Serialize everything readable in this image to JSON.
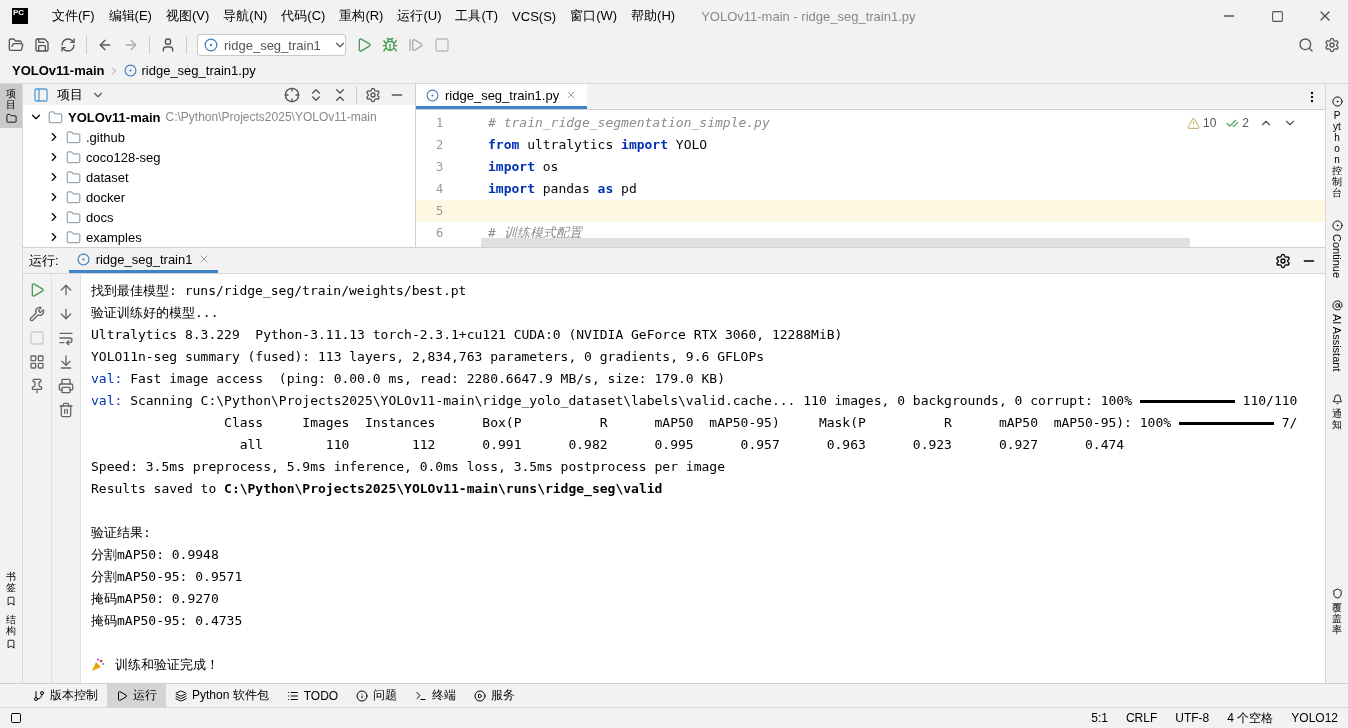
{
  "app": {
    "logo": "PC",
    "menu": [
      "文件(F)",
      "编辑(E)",
      "视图(V)",
      "导航(N)",
      "代码(C)",
      "重构(R)",
      "运行(U)",
      "工具(T)",
      "VCS(S)",
      "窗口(W)",
      "帮助(H)"
    ],
    "title": "YOLOv11-main - ridge_seg_train1.py"
  },
  "toolbar": {
    "run_config": "ridge_seg_train1"
  },
  "breadcrumb": [
    "YOLOv11-main",
    "ridge_seg_train1.py"
  ],
  "left_strip": [
    {
      "label": "项目",
      "selected": true
    },
    {
      "label": "书签",
      "selected": false
    },
    {
      "label": "结构",
      "selected": false
    }
  ],
  "project": {
    "title": "项目",
    "root": {
      "name": "YOLOv11-main",
      "path": "C:\\Python\\Projects2025\\YOLOv11-main",
      "expanded": true,
      "children": [
        {
          "name": ".github",
          "expanded": false
        },
        {
          "name": "coco128-seg",
          "expanded": false
        },
        {
          "name": "dataset",
          "expanded": false
        },
        {
          "name": "docker",
          "expanded": false
        },
        {
          "name": "docs",
          "expanded": false
        },
        {
          "name": "examples",
          "expanded": false
        }
      ]
    }
  },
  "editor": {
    "tabs": [
      {
        "label": "ridge_seg_train1.py",
        "selected": true
      }
    ],
    "warnings": "10",
    "checks": "2",
    "lines": [
      {
        "number": "1",
        "current": false,
        "tokens": [
          {
            "kind": "comment",
            "text": "# train_ridge_segmentation_simple.py"
          }
        ]
      },
      {
        "number": "2",
        "current": false,
        "tokens": [
          {
            "kind": "keyword",
            "text": "from"
          },
          {
            "kind": "plain",
            "text": " ultralytics "
          },
          {
            "kind": "keyword",
            "text": "import"
          },
          {
            "kind": "plain",
            "text": " YOLO"
          }
        ]
      },
      {
        "number": "3",
        "current": false,
        "tokens": [
          {
            "kind": "keyword",
            "text": "import"
          },
          {
            "kind": "plain",
            "text": " os"
          }
        ]
      },
      {
        "number": "4",
        "current": false,
        "tokens": [
          {
            "kind": "keyword",
            "text": "import"
          },
          {
            "kind": "plain",
            "text": " pandas "
          },
          {
            "kind": "keyword",
            "text": "as"
          },
          {
            "kind": "plain",
            "text": " pd"
          }
        ]
      },
      {
        "number": "5",
        "current": true
      },
      {
        "number": "6",
        "current": false,
        "tokens": [
          {
            "kind": "comment",
            "text": "# 训练模式配置"
          }
        ]
      }
    ]
  },
  "run": {
    "label": "运行:",
    "tab": "ridge_seg_train1",
    "console": [
      {
        "kind": "text",
        "text": "找到最佳模型: runs/ridge_seg/train/weights/best.pt"
      },
      {
        "kind": "text",
        "text": "验证训练好的模型..."
      },
      {
        "kind": "text",
        "text": "Ultralytics 8.3.229  Python-3.11.13 torch-2.3.1+cu121 CUDA:0 (NVIDIA GeForce RTX 3060, 12288MiB)"
      },
      {
        "kind": "text",
        "text": "YOLO11n-seg summary (fused): 113 layers, 2,834,763 parameters, 0 gradients, 9.6 GFLOPs"
      },
      {
        "kind": "tagged",
        "tag": "val:",
        "text": " Fast image access  (ping: 0.00.0 ms, read: 2280.6647.9 MB/s, size: 179.0 KB)"
      },
      {
        "kind": "progress",
        "tag": "val:",
        "text": " Scanning C:\\Python\\Projects2025\\YOLOv11-main\\ridge_yolo_dataset\\labels\\valid.cache... 110 images, 0 backgrounds, 0 corrupt: 100% ",
        "level": 1,
        "after": " 110/110"
      },
      {
        "kind": "progress",
        "text": "                 Class     Images  Instances      Box(P          R      mAP50  mAP50-95)     Mask(P          R      mAP50  mAP50-95): 100% ",
        "level": 1,
        "after": " 7/"
      },
      {
        "kind": "text",
        "text": "                   all        110        112      0.991      0.982      0.995      0.957      0.963      0.923      0.927      0.474"
      },
      {
        "kind": "text",
        "text": "Speed: 3.5ms preprocess, 5.9ms inference, 0.0ms loss, 3.5ms postprocess per image"
      },
      {
        "kind": "text",
        "text": "Results saved to **C:\\Python\\Projects2025\\YOLOv11-main\\runs\\ridge_seg\\valid**"
      },
      {
        "kind": "gap"
      },
      {
        "kind": "text",
        "text": "验证结果:"
      },
      {
        "kind": "text",
        "text": "分割mAP50: 0.9948"
      },
      {
        "kind": "text",
        "text": "分割mAP50-95: 0.9571"
      },
      {
        "kind": "text",
        "text": "掩码mAP50: 0.9270"
      },
      {
        "kind": "text",
        "text": "掩码mAP50-95: 0.4735"
      },
      {
        "kind": "gap"
      },
      {
        "kind": "party",
        "text": "训练和验证完成！"
      }
    ]
  },
  "right_strip": [
    "Python 控制台",
    "Continue",
    "AI Assistant",
    "通知",
    "覆盖率"
  ],
  "bottom_tabs": [
    {
      "label": "版本控制",
      "selected": false
    },
    {
      "label": "运行",
      "selected": true
    },
    {
      "label": "Python 软件包",
      "selected": false
    },
    {
      "label": "TODO",
      "selected": false
    },
    {
      "label": "问题",
      "selected": false
    },
    {
      "label": "终端",
      "selected": false
    },
    {
      "label": "服务",
      "selected": false
    }
  ],
  "status": [
    "5:1",
    "CRLF",
    "UTF-8",
    "4 个空格",
    "YOLO12"
  ]
}
